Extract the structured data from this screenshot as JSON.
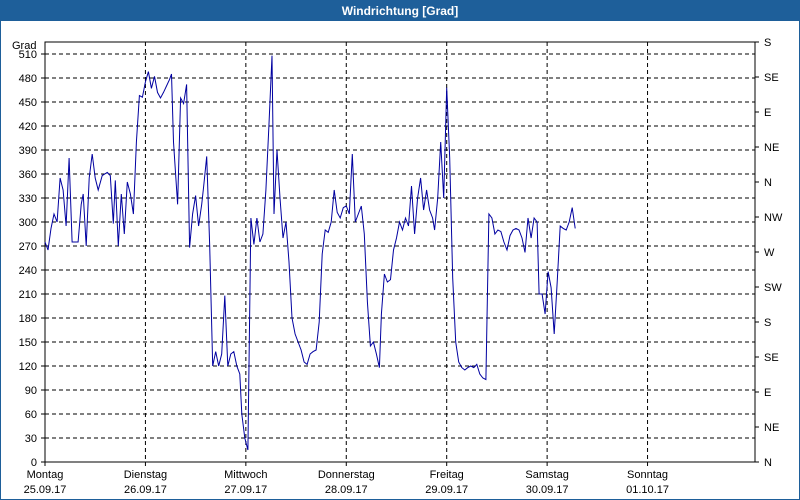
{
  "window": {
    "title": "Windrichtung [Grad]"
  },
  "colors": {
    "title_bar": "#1e5f9a",
    "line": "#0000a0",
    "grid": "#000000"
  },
  "chart_data": {
    "type": "line",
    "title": "Windrichtung [Grad]",
    "ylabel": "Grad",
    "ylim": [
      0,
      525
    ],
    "yticks": [
      0,
      30,
      60,
      90,
      120,
      150,
      180,
      210,
      240,
      270,
      300,
      330,
      360,
      390,
      420,
      450,
      480,
      510
    ],
    "y2_labels": [
      "N",
      "NE",
      "E",
      "SE",
      "S",
      "SW",
      "W",
      "NW",
      "N",
      "NE",
      "E",
      "SE",
      "S"
    ],
    "xlim": [
      0,
      7.07
    ],
    "xticks": [
      {
        "day": "Montag",
        "date": "25.09.17"
      },
      {
        "day": "Dienstag",
        "date": "26.09.17"
      },
      {
        "day": "Mittwoch",
        "date": "27.09.17"
      },
      {
        "day": "Donnerstag",
        "date": "28.09.17"
      },
      {
        "day": "Freitag",
        "date": "29.09.17"
      },
      {
        "day": "Samstag",
        "date": "30.09.17"
      },
      {
        "day": "Sonntag",
        "date": "01.10.17"
      }
    ],
    "grid": true,
    "series": [
      {
        "points": [
          [
            0.0,
            275
          ],
          [
            0.03,
            265
          ],
          [
            0.06,
            292
          ],
          [
            0.09,
            310
          ],
          [
            0.12,
            300
          ],
          [
            0.15,
            355
          ],
          [
            0.18,
            340
          ],
          [
            0.21,
            295
          ],
          [
            0.24,
            380
          ],
          [
            0.27,
            275
          ],
          [
            0.3,
            275
          ],
          [
            0.33,
            275
          ],
          [
            0.36,
            322
          ],
          [
            0.38,
            335
          ],
          [
            0.41,
            270
          ],
          [
            0.44,
            355
          ],
          [
            0.47,
            385
          ],
          [
            0.5,
            355
          ],
          [
            0.53,
            340
          ],
          [
            0.57,
            358
          ],
          [
            0.62,
            362
          ],
          [
            0.65,
            358
          ],
          [
            0.68,
            298
          ],
          [
            0.7,
            352
          ],
          [
            0.73,
            270
          ],
          [
            0.76,
            335
          ],
          [
            0.79,
            285
          ],
          [
            0.82,
            350
          ],
          [
            0.85,
            335
          ],
          [
            0.88,
            310
          ],
          [
            0.91,
            400
          ],
          [
            0.94,
            458
          ],
          [
            0.97,
            456
          ],
          [
            1.0,
            475
          ],
          [
            1.03,
            488
          ],
          [
            1.06,
            467
          ],
          [
            1.09,
            482
          ],
          [
            1.12,
            462
          ],
          [
            1.15,
            455
          ],
          [
            1.18,
            462
          ],
          [
            1.21,
            470
          ],
          [
            1.24,
            478
          ],
          [
            1.26,
            485
          ],
          [
            1.28,
            400
          ],
          [
            1.3,
            360
          ],
          [
            1.32,
            322
          ],
          [
            1.35,
            455
          ],
          [
            1.38,
            448
          ],
          [
            1.41,
            472
          ],
          [
            1.44,
            268
          ],
          [
            1.47,
            310
          ],
          [
            1.5,
            333
          ],
          [
            1.53,
            295
          ],
          [
            1.56,
            322
          ],
          [
            1.58,
            345
          ],
          [
            1.61,
            382
          ],
          [
            1.64,
            270
          ],
          [
            1.67,
            120
          ],
          [
            1.7,
            138
          ],
          [
            1.73,
            120
          ],
          [
            1.76,
            135
          ],
          [
            1.79,
            208
          ],
          [
            1.82,
            120
          ],
          [
            1.85,
            135
          ],
          [
            1.88,
            138
          ],
          [
            1.91,
            120
          ],
          [
            1.94,
            110
          ],
          [
            1.96,
            60
          ],
          [
            1.99,
            30
          ],
          [
            2.02,
            15
          ],
          [
            2.05,
            305
          ],
          [
            2.08,
            272
          ],
          [
            2.11,
            305
          ],
          [
            2.14,
            275
          ],
          [
            2.17,
            285
          ],
          [
            2.2,
            340
          ],
          [
            2.23,
            420
          ],
          [
            2.26,
            508
          ],
          [
            2.28,
            310
          ],
          [
            2.31,
            390
          ],
          [
            2.34,
            330
          ],
          [
            2.37,
            280
          ],
          [
            2.4,
            300
          ],
          [
            2.43,
            250
          ],
          [
            2.46,
            180
          ],
          [
            2.49,
            160
          ],
          [
            2.52,
            150
          ],
          [
            2.55,
            140
          ],
          [
            2.58,
            125
          ],
          [
            2.61,
            122
          ],
          [
            2.64,
            135
          ],
          [
            2.67,
            138
          ],
          [
            2.7,
            140
          ],
          [
            2.73,
            175
          ],
          [
            2.76,
            260
          ],
          [
            2.79,
            290
          ],
          [
            2.82,
            287
          ],
          [
            2.85,
            300
          ],
          [
            2.88,
            340
          ],
          [
            2.91,
            312
          ],
          [
            2.94,
            305
          ],
          [
            2.97,
            318
          ],
          [
            3.0,
            320
          ],
          [
            3.03,
            310
          ],
          [
            3.06,
            385
          ],
          [
            3.09,
            300
          ],
          [
            3.12,
            310
          ],
          [
            3.15,
            320
          ],
          [
            3.18,
            285
          ],
          [
            3.21,
            200
          ],
          [
            3.24,
            145
          ],
          [
            3.27,
            150
          ],
          [
            3.3,
            135
          ],
          [
            3.33,
            118
          ],
          [
            3.35,
            185
          ],
          [
            3.38,
            235
          ],
          [
            3.41,
            225
          ],
          [
            3.44,
            228
          ],
          [
            3.47,
            265
          ],
          [
            3.5,
            280
          ],
          [
            3.53,
            300
          ],
          [
            3.56,
            290
          ],
          [
            3.59,
            305
          ],
          [
            3.62,
            295
          ],
          [
            3.65,
            345
          ],
          [
            3.68,
            285
          ],
          [
            3.71,
            330
          ],
          [
            3.74,
            355
          ],
          [
            3.77,
            315
          ],
          [
            3.8,
            340
          ],
          [
            3.83,
            315
          ],
          [
            3.86,
            305
          ],
          [
            3.88,
            290
          ],
          [
            3.91,
            330
          ],
          [
            3.94,
            400
          ],
          [
            3.97,
            330
          ],
          [
            4.0,
            468
          ],
          [
            4.03,
            380
          ],
          [
            4.06,
            230
          ],
          [
            4.09,
            150
          ],
          [
            4.12,
            125
          ],
          [
            4.15,
            118
          ],
          [
            4.18,
            115
          ],
          [
            4.21,
            118
          ],
          [
            4.24,
            120
          ],
          [
            4.27,
            118
          ],
          [
            4.3,
            122
          ],
          [
            4.33,
            110
          ],
          [
            4.36,
            105
          ],
          [
            4.39,
            103
          ],
          [
            4.42,
            310
          ],
          [
            4.45,
            305
          ],
          [
            4.48,
            285
          ],
          [
            4.51,
            290
          ],
          [
            4.54,
            288
          ],
          [
            4.57,
            275
          ],
          [
            4.6,
            265
          ],
          [
            4.63,
            283
          ],
          [
            4.66,
            290
          ],
          [
            4.69,
            292
          ],
          [
            4.72,
            290
          ],
          [
            4.75,
            280
          ],
          [
            4.78,
            262
          ],
          [
            4.81,
            305
          ],
          [
            4.84,
            280
          ],
          [
            4.87,
            305
          ],
          [
            4.9,
            300
          ],
          [
            4.92,
            210
          ],
          [
            4.95,
            210
          ],
          [
            4.98,
            185
          ],
          [
            5.01,
            238
          ],
          [
            5.04,
            218
          ],
          [
            5.07,
            160
          ],
          [
            5.1,
            225
          ],
          [
            5.13,
            295
          ],
          [
            5.16,
            292
          ],
          [
            5.19,
            290
          ],
          [
            5.22,
            300
          ],
          [
            5.25,
            318
          ],
          [
            5.28,
            292
          ]
        ]
      }
    ]
  }
}
